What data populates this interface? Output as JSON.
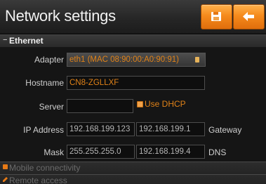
{
  "header": {
    "title": "Network settings"
  },
  "sections": {
    "ethernet": "Ethernet",
    "mobile": "Mobile connectivity",
    "remote": "Remote access"
  },
  "form": {
    "adapter_label": "Adapter",
    "adapter_value": "eth1 (MAC 08:90:00:A0:90:91)",
    "hostname_label": "Hostname",
    "hostname_value": "CN8-ZGLLXF",
    "server_label": "Server",
    "server_value": "",
    "use_dhcp_label": "Use DHCP",
    "ip_label": "IP Address",
    "ip_value": "192.168.199.123",
    "gateway_value": "192.168.199.1",
    "gateway_label": "Gateway",
    "mask_label": "Mask",
    "mask_value": "255.255.255.0",
    "dns_value": "192.168.199.4",
    "dns_label": "DNS"
  },
  "colors": {
    "accent": "#f08a1c",
    "value_orange": "#e08218"
  },
  "icons": {
    "save": "save-icon",
    "back": "back-arrow-icon"
  }
}
